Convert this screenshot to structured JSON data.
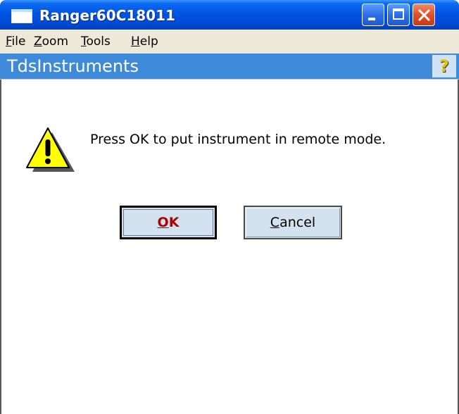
{
  "window": {
    "title": "Ranger60C18011",
    "controls": {
      "minimize": "minimize-icon",
      "maximize": "maximize-icon",
      "close": "close-icon"
    }
  },
  "menubar": {
    "items": [
      {
        "mnemonic": "F",
        "rest": "ile"
      },
      {
        "mnemonic": "Z",
        "rest": "oom"
      },
      {
        "mnemonic": "T",
        "rest": "ools"
      },
      {
        "mnemonic": "H",
        "rest": "elp"
      }
    ]
  },
  "header": {
    "title": "TdsInstruments",
    "help_icon": "question-mark-icon",
    "help_glyph": "?"
  },
  "dialog": {
    "icon": "warning-icon",
    "message": "Press OK to put instrument in remote mode.",
    "ok_button": {
      "mnemonic": "O",
      "rest": "K"
    },
    "cancel_button": {
      "mnemonic": "C",
      "rest": "ancel"
    }
  },
  "colors": {
    "titlebar": "#0054e3",
    "menubar": "#ece9d8",
    "header_band": "#3e8ad8",
    "button_face": "#d4e2ef",
    "ok_text": "#b00000",
    "warning_fill": "#ffff00"
  }
}
